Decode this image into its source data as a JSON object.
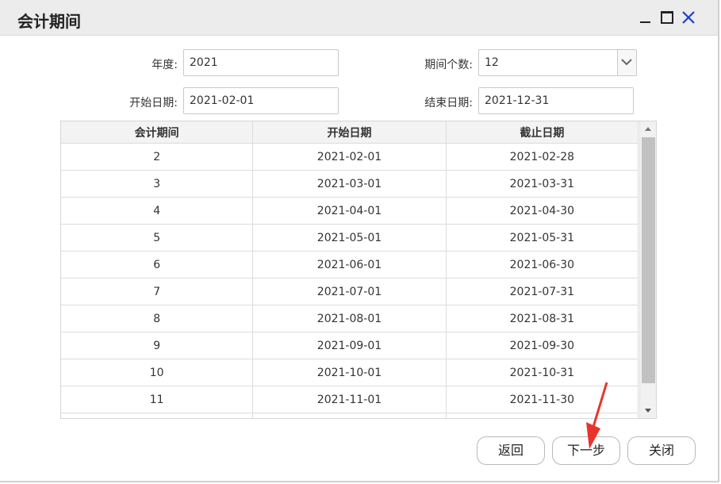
{
  "window": {
    "title": "会计期间"
  },
  "form": {
    "year_label": "年度:",
    "year_value": "2021",
    "period_count_label": "期间个数:",
    "period_count_value": "12",
    "start_date_label": "开始日期:",
    "start_date_value": "2021-02-01",
    "end_date_label": "结束日期:",
    "end_date_value": "2021-12-31"
  },
  "table": {
    "headers": [
      "会计期间",
      "开始日期",
      "截止日期"
    ],
    "rows": [
      [
        "2",
        "2021-02-01",
        "2021-02-28"
      ],
      [
        "3",
        "2021-03-01",
        "2021-03-31"
      ],
      [
        "4",
        "2021-04-01",
        "2021-04-30"
      ],
      [
        "5",
        "2021-05-01",
        "2021-05-31"
      ],
      [
        "6",
        "2021-06-01",
        "2021-06-30"
      ],
      [
        "7",
        "2021-07-01",
        "2021-07-31"
      ],
      [
        "8",
        "2021-08-01",
        "2021-08-31"
      ],
      [
        "9",
        "2021-09-01",
        "2021-09-30"
      ],
      [
        "10",
        "2021-10-01",
        "2021-10-31"
      ],
      [
        "11",
        "2021-11-01",
        "2021-11-30"
      ]
    ]
  },
  "buttons": {
    "back": "返回",
    "next": "下一步",
    "close": "关闭"
  },
  "icons": {
    "minimize": "minimize-icon",
    "maximize": "maximize-icon",
    "close": "close-icon",
    "dropdown": "chevron-down-icon"
  },
  "colors": {
    "close_icon": "#1a3fd1",
    "annotation_arrow": "#e8342c"
  }
}
